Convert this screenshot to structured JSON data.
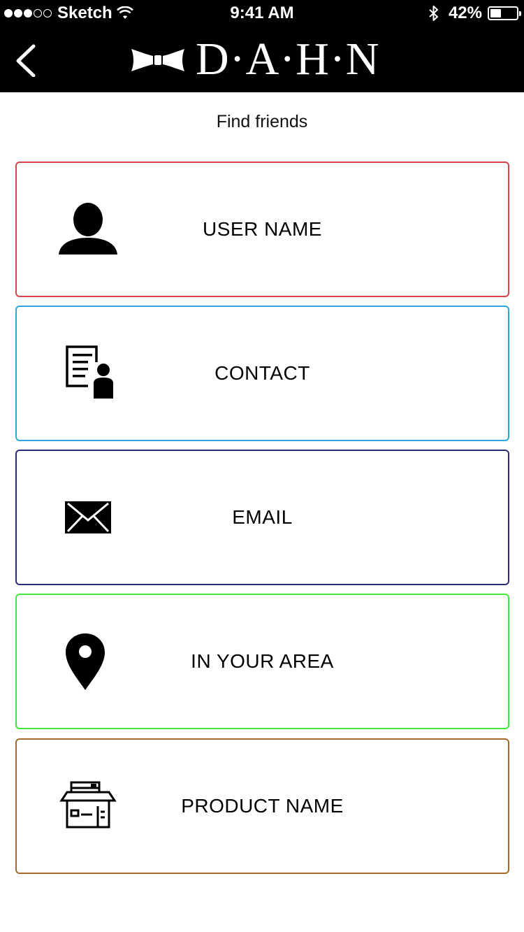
{
  "status_bar": {
    "carrier": "Sketch",
    "time": "9:41 AM",
    "battery_percent": "42%",
    "battery_level": 0.42
  },
  "nav": {
    "brand": "D·A·H·N"
  },
  "page": {
    "title": "Find friends"
  },
  "options": [
    {
      "label": "USER NAME",
      "icon": "user-icon",
      "border_color": "#d9434b"
    },
    {
      "label": "CONTACT",
      "icon": "contact-card-icon",
      "border_color": "#29a8dc"
    },
    {
      "label": "EMAIL",
      "icon": "envelope-icon",
      "border_color": "#2d2a7c"
    },
    {
      "label": "IN YOUR AREA",
      "icon": "location-pin-icon",
      "border_color": "#3ee93e"
    },
    {
      "label": "PRODUCT NAME",
      "icon": "package-box-icon",
      "border_color": "#a56a2a"
    }
  ]
}
